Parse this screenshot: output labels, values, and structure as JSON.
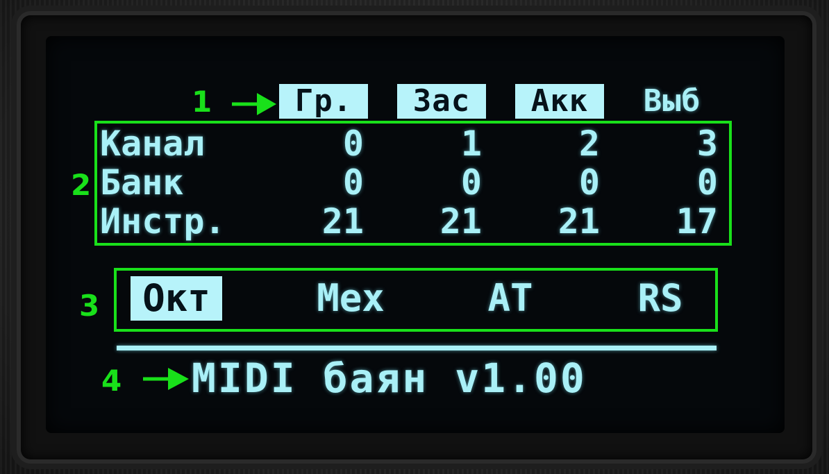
{
  "display": {
    "tabs": [
      {
        "label": "Гр.",
        "selected": true
      },
      {
        "label": "Зас",
        "selected": true
      },
      {
        "label": "Акк",
        "selected": true
      },
      {
        "label": "Выб",
        "selected": false
      }
    ],
    "table": {
      "rows": [
        {
          "label": "Канал",
          "values": [
            "0",
            "1",
            "2",
            "3"
          ]
        },
        {
          "label": "Банк",
          "values": [
            "0",
            "0",
            "0",
            "0"
          ]
        },
        {
          "label": "Инстр.",
          "values": [
            "21",
            "21",
            "21",
            "17"
          ]
        }
      ]
    },
    "modes": [
      {
        "label": "Окт",
        "selected": true
      },
      {
        "label": "Mex",
        "selected": false
      },
      {
        "label": "AT",
        "selected": false
      },
      {
        "label": "RS",
        "selected": false
      }
    ],
    "footer": "MIDI баян v1.00"
  },
  "annotations": {
    "labels": [
      "1",
      "2",
      "3",
      "4"
    ],
    "color": "#19e01a"
  },
  "colors": {
    "oled_text": "#a9f0f7",
    "oled_background": "#05080b",
    "annotation": "#19e01a"
  }
}
